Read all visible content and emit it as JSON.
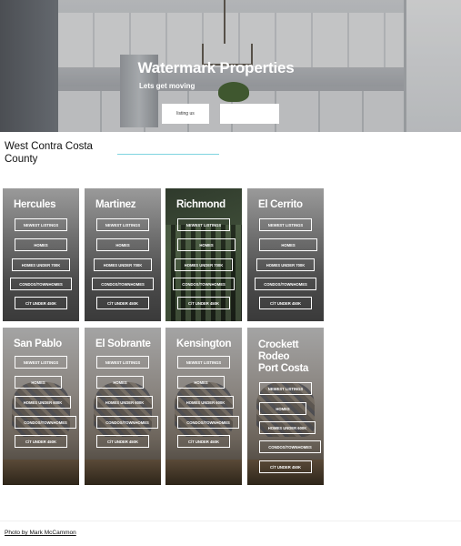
{
  "hero": {
    "title": "Watermark Properties",
    "tagline": "Lets get moving",
    "listing_button": "listing us",
    "blank_button": ""
  },
  "region": {
    "title": "West Contra Costa County"
  },
  "cards": [
    {
      "title": "Hercules",
      "links": [
        "NEWEST LISTINGS",
        "HOMES",
        "HOMES UNDER 700K",
        "CONDOS/TOWNHOMES",
        "C/T UNDER 450K"
      ]
    },
    {
      "title": "Martinez",
      "links": [
        "NEWEST LISTINGS",
        "HOMES",
        "HOMES UNDER 700K",
        "CONDOS/TOWNHOMES",
        "C/T UNDER 450K"
      ]
    },
    {
      "title": "Richmond",
      "links": [
        "NEWEST LISTINGS",
        "HOMES",
        "HOMES UNDER 700K",
        "CONDOS/TOWNHOMES",
        "C/T UNDER 450K"
      ]
    },
    {
      "title": "El Cerrito",
      "links": [
        "NEWEST LISTINGS",
        "HOMES",
        "HOMES UNDER 700K",
        "CONDOS/TOWNHOMES",
        "C/T UNDER 450K"
      ]
    },
    {
      "title": "San Pablo",
      "links": [
        "NEWEST LISTINGS",
        "HOMES",
        "HOMES UNDER 600K",
        "CONDOS/TOWNHOMES",
        "C/T UNDER 450K"
      ]
    },
    {
      "title": "El Sobrante",
      "links": [
        "NEWEST LISTINGS",
        "HOMES",
        "HOMES UNDER 600K",
        "CONDOS/TOWNHOMES",
        "C/T UNDER 450K"
      ]
    },
    {
      "title": "Kensington",
      "links": [
        "NEWEST LISTINGS",
        "HOMES",
        "HOMES UNDER 600K",
        "CONDOS/TOWNHOMES",
        "C/T UNDER 450K"
      ]
    },
    {
      "title_lines": [
        "Crockett",
        "Rodeo",
        "Port Costa"
      ],
      "links": [
        "NEWEST LISTINGS",
        "HOMES",
        "HOMES UNDER 600K",
        "CONDOS/TOWNHOMES",
        "C/T UNDER 450K"
      ]
    }
  ],
  "footer": {
    "photo_credit": "Photo by Mark McCammon"
  }
}
